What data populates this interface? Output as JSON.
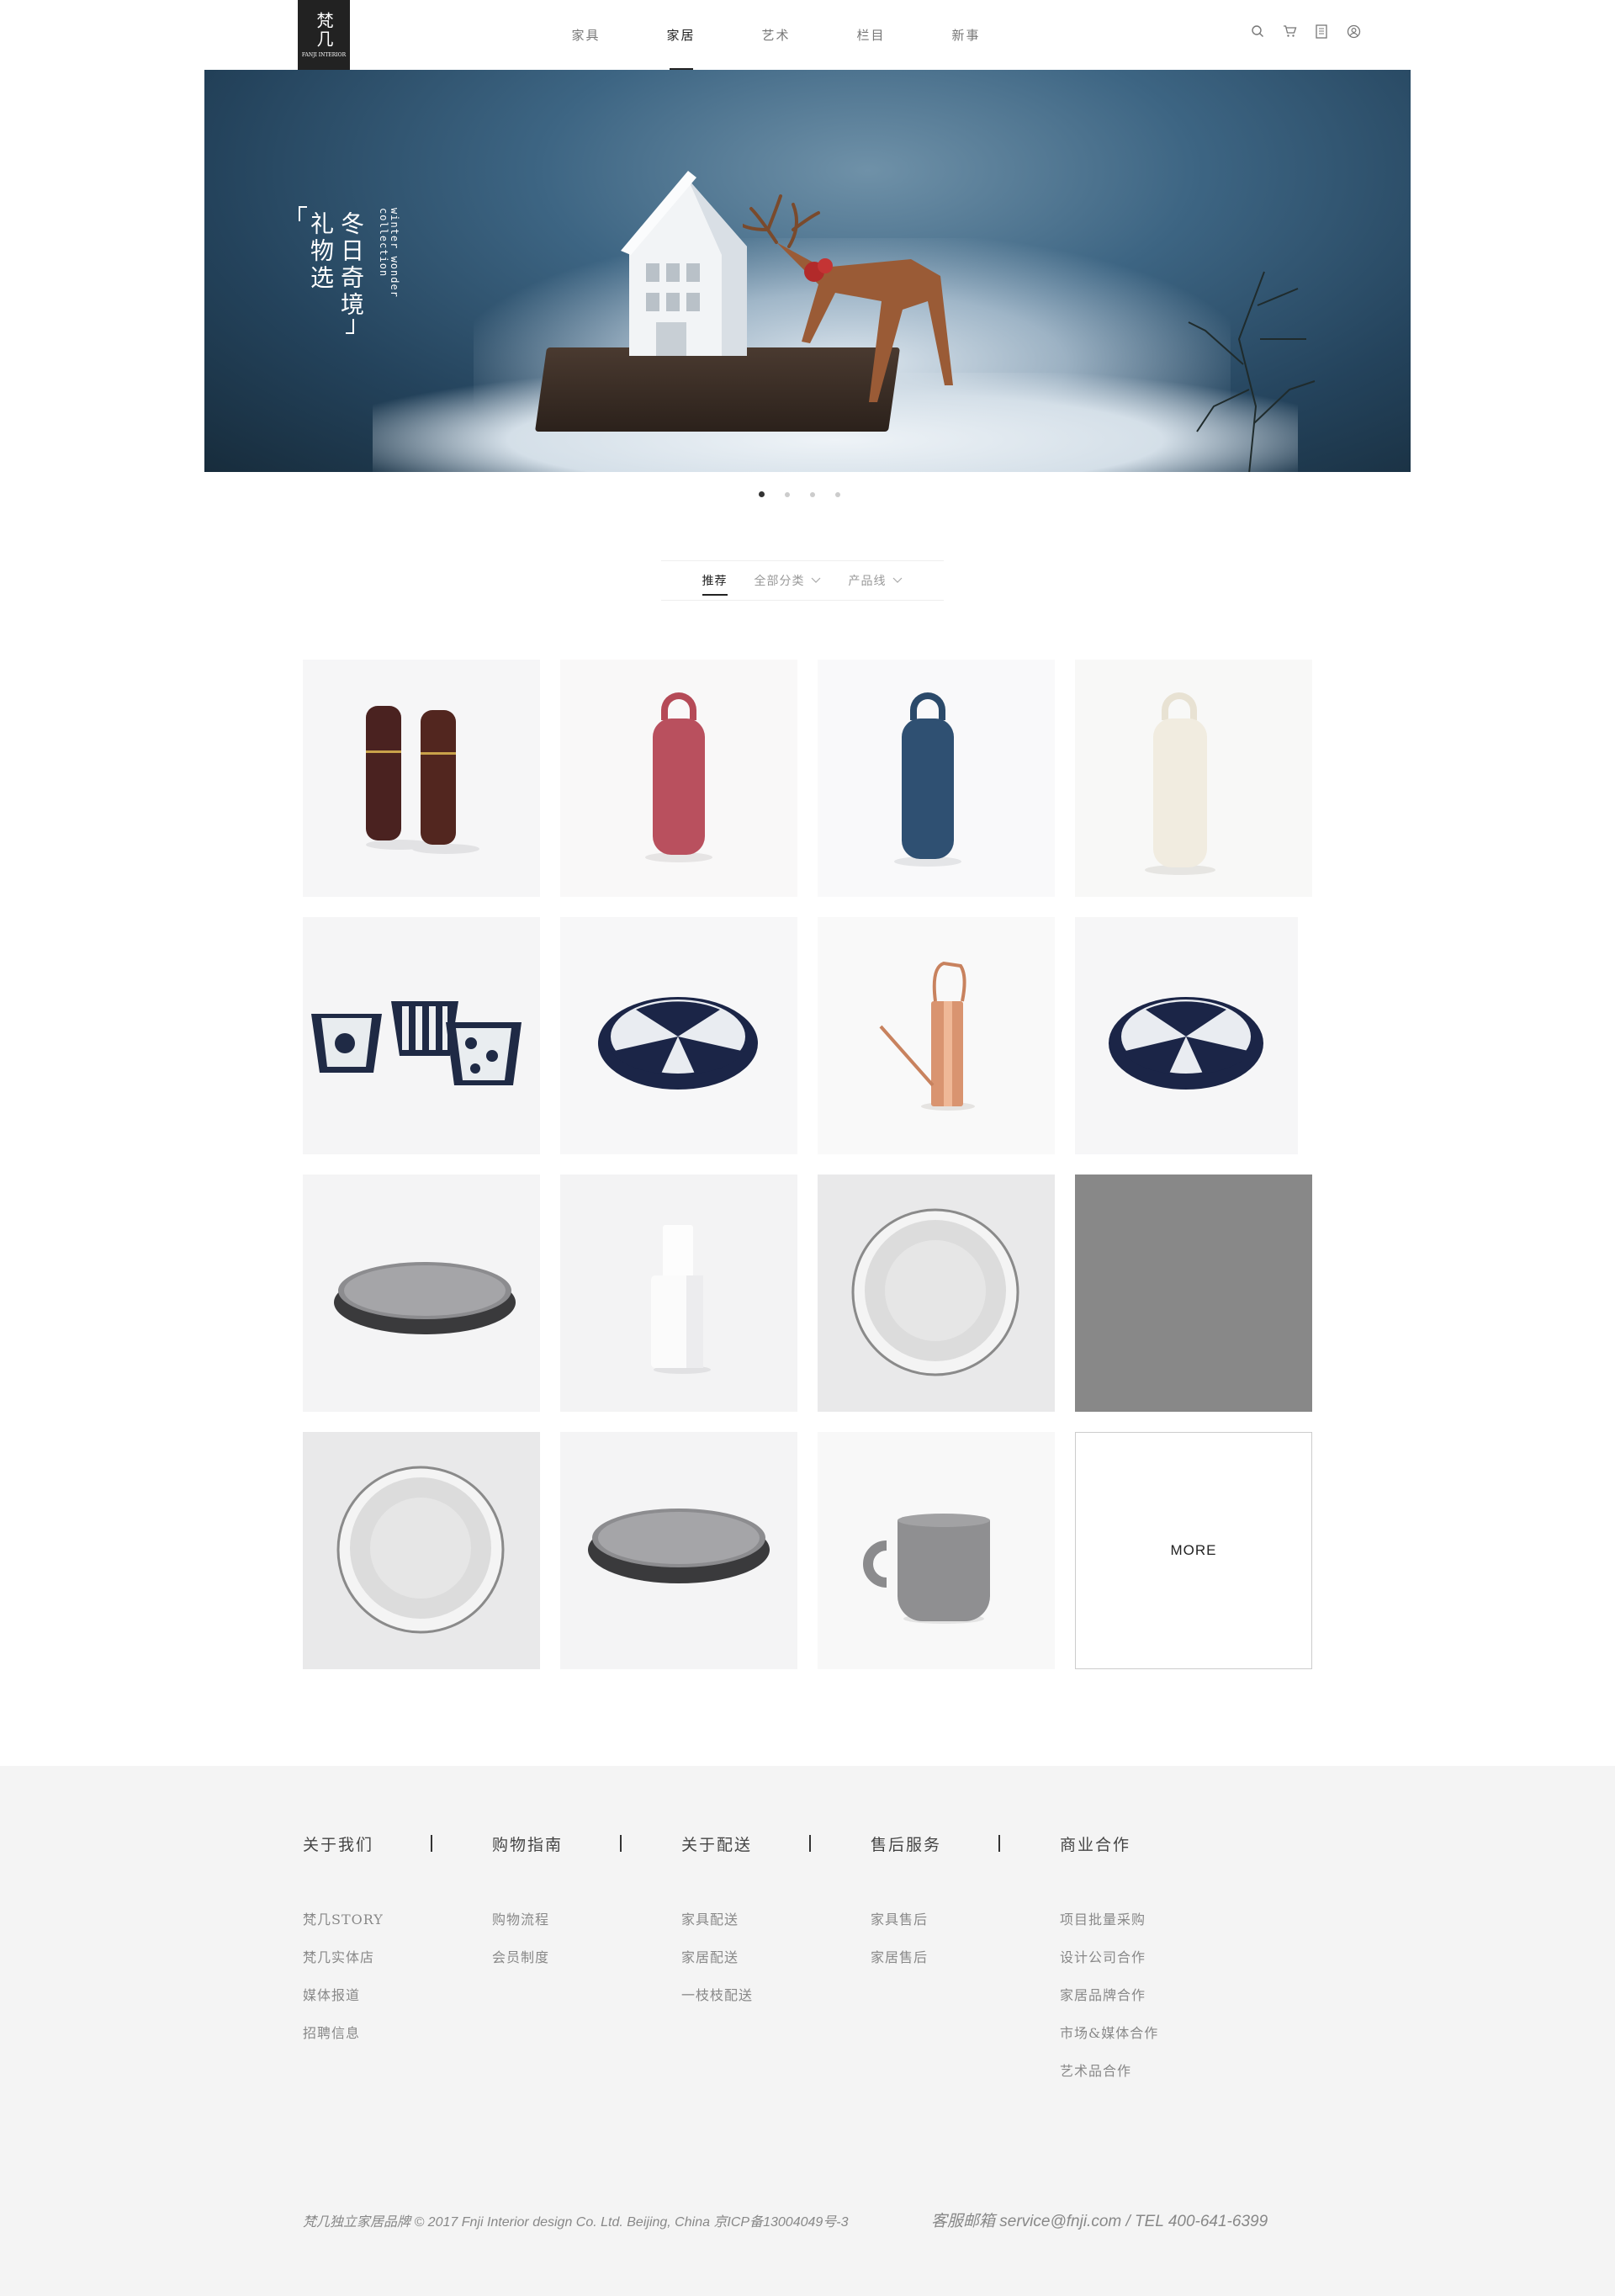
{
  "header": {
    "logo_text": "梵几",
    "logo_sub": "FANJI INTERIOR",
    "nav": [
      {
        "label": "家具",
        "active": false
      },
      {
        "label": "家居",
        "active": true
      },
      {
        "label": "艺术",
        "active": false
      },
      {
        "label": "栏目",
        "active": false
      },
      {
        "label": "新事",
        "active": false
      }
    ],
    "icons": [
      "search-icon",
      "cart-icon",
      "document-icon",
      "user-icon"
    ]
  },
  "banner": {
    "title": "冬日奇境礼物选",
    "title_col1": "礼物选",
    "title_col2": "冬日奇境",
    "subtitle": "winter wonder collection",
    "slide_count": 4,
    "active_slide": 1
  },
  "filters": {
    "tabs": [
      {
        "label": "推荐",
        "active": true,
        "dropdown": false
      },
      {
        "label": "全部分类",
        "active": false,
        "dropdown": true
      },
      {
        "label": "产品线",
        "active": false,
        "dropdown": true
      }
    ]
  },
  "products": [
    {
      "name": "dark-wood-salt-pepper-mills"
    },
    {
      "name": "pink-bottle"
    },
    {
      "name": "navy-bottle"
    },
    {
      "name": "cream-bottle"
    },
    {
      "name": "striped-ceramic-pots"
    },
    {
      "name": "navy-plate-large"
    },
    {
      "name": "copper-watering-can"
    },
    {
      "name": "navy-plate-small"
    },
    {
      "name": "dark-stone-tray"
    },
    {
      "name": "white-ceramic-vase"
    },
    {
      "name": "white-bowl-top"
    },
    {
      "name": "gray-placeholder"
    },
    {
      "name": "white-bowl-top-2"
    },
    {
      "name": "dark-stone-tray-2"
    },
    {
      "name": "gray-mug"
    }
  ],
  "more_label": "MORE",
  "footer": {
    "columns": [
      {
        "title": "关于我们",
        "links": [
          "梵几STORY",
          "梵几实体店",
          "媒体报道",
          "招聘信息"
        ]
      },
      {
        "title": "购物指南",
        "links": [
          "购物流程",
          "会员制度"
        ]
      },
      {
        "title": "关于配送",
        "links": [
          "家具配送",
          "家居配送",
          "一枝枝配送"
        ]
      },
      {
        "title": "售后服务",
        "links": [
          "家具售后",
          "家居售后"
        ]
      },
      {
        "title": "商业合作",
        "links": [
          "项目批量采购",
          "设计公司合作",
          "家居品牌合作",
          "市场&媒体合作",
          "艺术品合作"
        ]
      }
    ],
    "copyright": "梵几独立家居品牌 © 2017 Fnji Interior design Co. Ltd. Beijing, China 京ICP备13004049号-3",
    "contact": "客服邮箱 service@fnji.com   /   TEL 400-641-6399"
  },
  "colors": {
    "accent": "#222222",
    "footer_bg": "#f4f4f4",
    "banner_blue": "#2b4d66"
  }
}
